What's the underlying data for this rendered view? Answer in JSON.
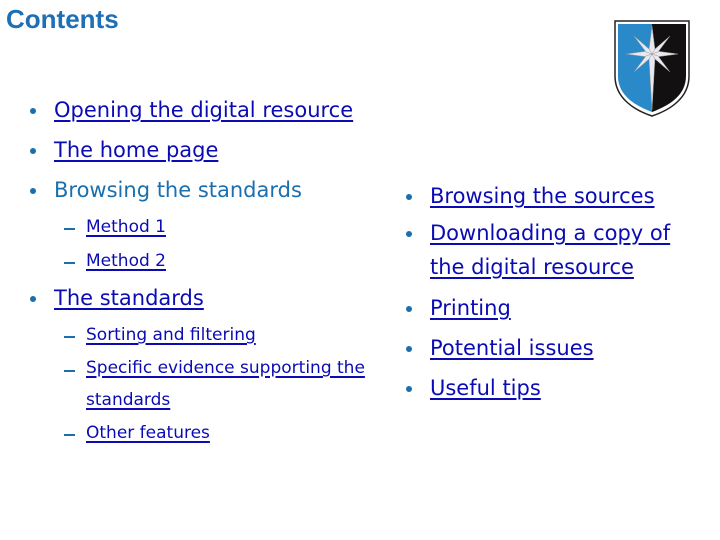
{
  "page": {
    "title": "Contents",
    "logo_icon": "shield-compass-star-icon",
    "colors": {
      "title": "#1f6fb5",
      "bullet": "#1a6fae",
      "link": "#0b0bb4",
      "shield_blue": "#2a8ac9",
      "shield_black": "#121010"
    }
  },
  "left_list": {
    "items": [
      {
        "label": "Opening the digital resource",
        "link": true
      },
      {
        "label": "The home page",
        "link": true
      },
      {
        "label": "Browsing the standards",
        "link": false,
        "children": [
          {
            "label": "Method 1",
            "link": true
          },
          {
            "label": "Method 2",
            "link": true
          }
        ]
      },
      {
        "label": "The standards",
        "link": true,
        "children": [
          {
            "label": "Sorting and filtering",
            "link": true
          },
          {
            "label": "Specific evidence supporting the standards",
            "link": true
          },
          {
            "label": "Other features",
            "link": true
          }
        ]
      }
    ]
  },
  "right_list": {
    "items": [
      {
        "label": "Browsing the sources",
        "link": true
      },
      {
        "label": "Downloading a copy of the digital resource",
        "link": true
      },
      {
        "label": "Printing",
        "link": true
      },
      {
        "label": "Potential issues",
        "link": true
      },
      {
        "label": "Useful tips",
        "link": true
      }
    ]
  }
}
